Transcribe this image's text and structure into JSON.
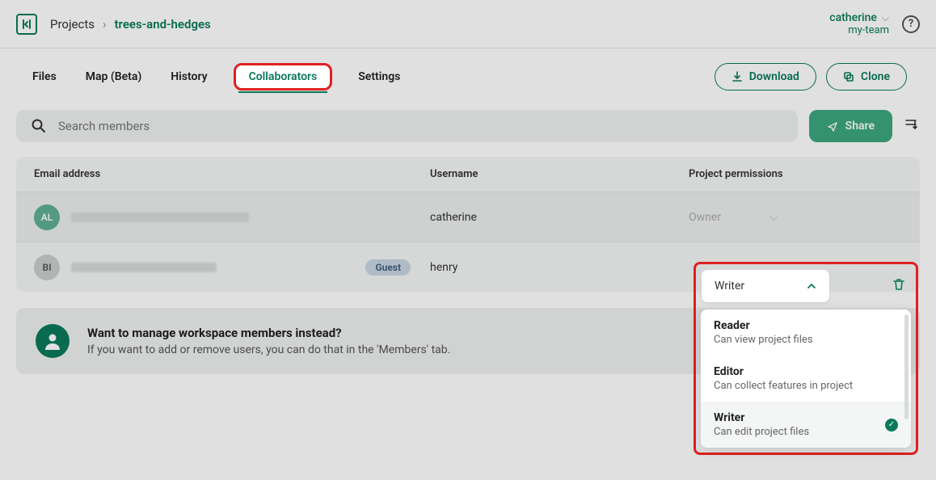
{
  "header": {
    "breadcrumb_root": "Projects",
    "breadcrumb_sep": "›",
    "breadcrumb_current": "trees-and-hedges",
    "user_name": "catherine",
    "user_team": "my-team",
    "help_glyph": "?"
  },
  "tabs": {
    "files": "Files",
    "map": "Map (Beta)",
    "history": "History",
    "collaborators": "Collaborators",
    "settings": "Settings"
  },
  "actions": {
    "download": "Download",
    "clone": "Clone"
  },
  "search": {
    "placeholder": "Search members",
    "share": "Share"
  },
  "table": {
    "col_email": "Email address",
    "col_username": "Username",
    "col_perm": "Project permissions",
    "rows": [
      {
        "initials": "AL",
        "username": "catherine",
        "perm": "Owner",
        "guest": false
      },
      {
        "initials": "BI",
        "username": "henry",
        "perm": "Writer",
        "guest": true
      }
    ],
    "guest_badge": "Guest"
  },
  "callout": {
    "title": "Want to manage workspace members instead?",
    "text": "If you want to add or remove users, you can do that in the 'Members' tab."
  },
  "perm_dropdown": {
    "selected": "Writer",
    "options": [
      {
        "title": "Reader",
        "desc": "Can view project files",
        "selected": false
      },
      {
        "title": "Editor",
        "desc": "Can collect features in project",
        "selected": false
      },
      {
        "title": "Writer",
        "desc": "Can edit project files",
        "selected": true
      }
    ]
  }
}
